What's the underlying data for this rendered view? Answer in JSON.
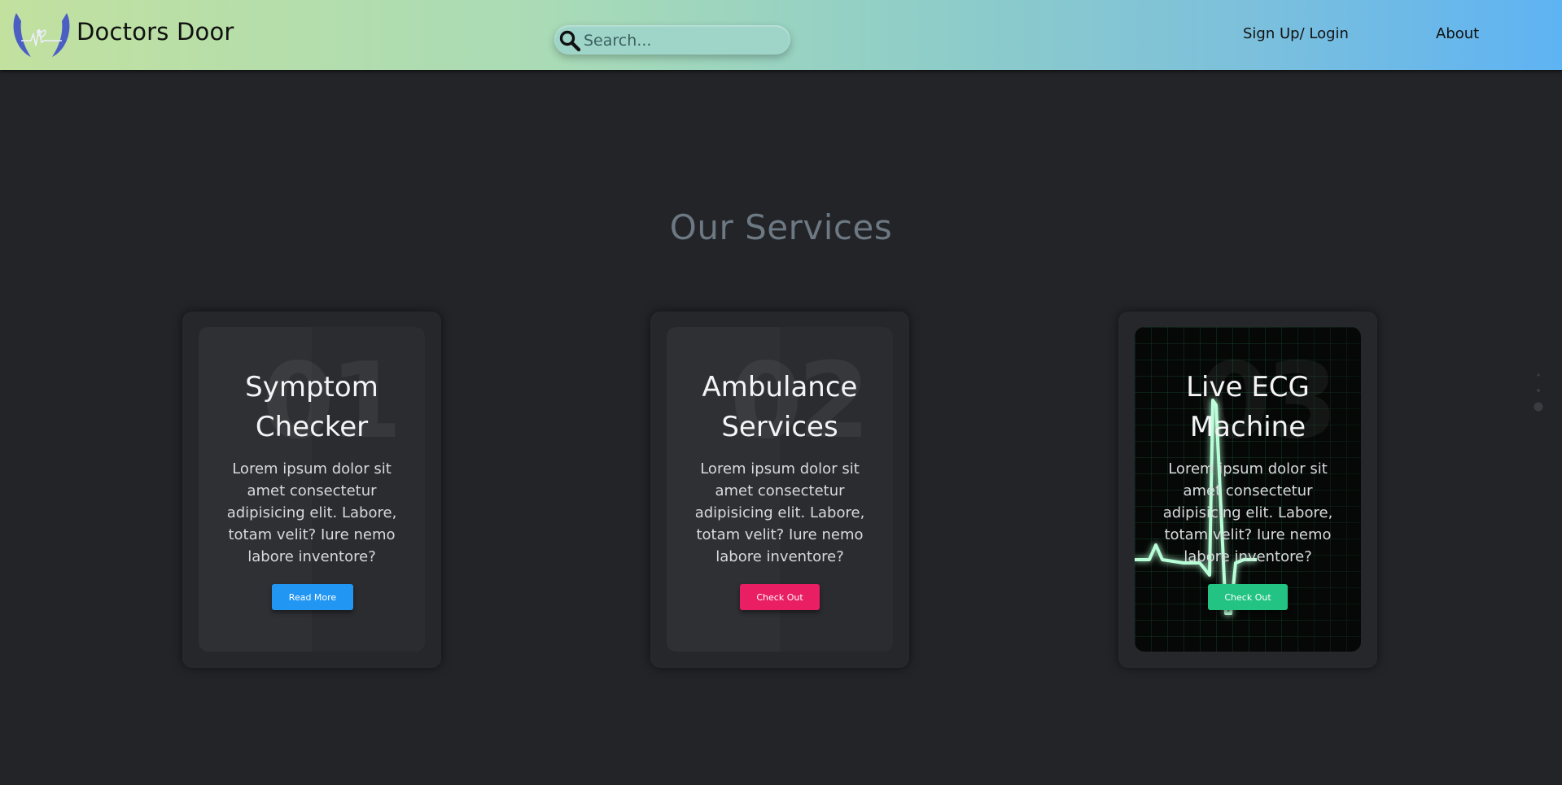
{
  "navbar": {
    "brand": "Doctors Door",
    "search_placeholder": "Search...",
    "links": [
      "Sign Up/ Login",
      "About"
    ]
  },
  "main": {
    "title": "Our Services",
    "cards": [
      {
        "number": "01",
        "title_lines": [
          "Symptom",
          "Checker"
        ],
        "text_lines": [
          "Lorem ipsum dolor sit",
          "amet consectetur",
          "adipisicing elit. Labore,",
          "totam velit? Iure nemo",
          "labore inventore?"
        ],
        "button": "Read More",
        "button_color": "#2196f3"
      },
      {
        "number": "02",
        "title_lines": [
          "Ambulance",
          "Services"
        ],
        "text_lines": [
          "Lorem ipsum dolor sit",
          "amet consectetur",
          "adipisicing elit. Labore,",
          "totam velit? Iure nemo",
          "labore inventore?"
        ],
        "button": "Check Out",
        "button_color": "#e91e63"
      },
      {
        "number": "03",
        "title_lines": [
          "Live ECG",
          "Machine"
        ],
        "text_lines": [
          "Lorem ipsum dolor sit",
          "amet consectetur",
          "adipisicing elit. Labore,",
          "totam velit? Iure nemo",
          "labore inventore?"
        ],
        "button": "Check Out",
        "button_color": "#23c483"
      }
    ]
  },
  "colors": {
    "page_bg": "#232428",
    "title": "#6c7882",
    "ecg_glow": "#9ff5c8"
  },
  "icons": [
    "doctor-hands-logo-icon",
    "search-icon"
  ]
}
